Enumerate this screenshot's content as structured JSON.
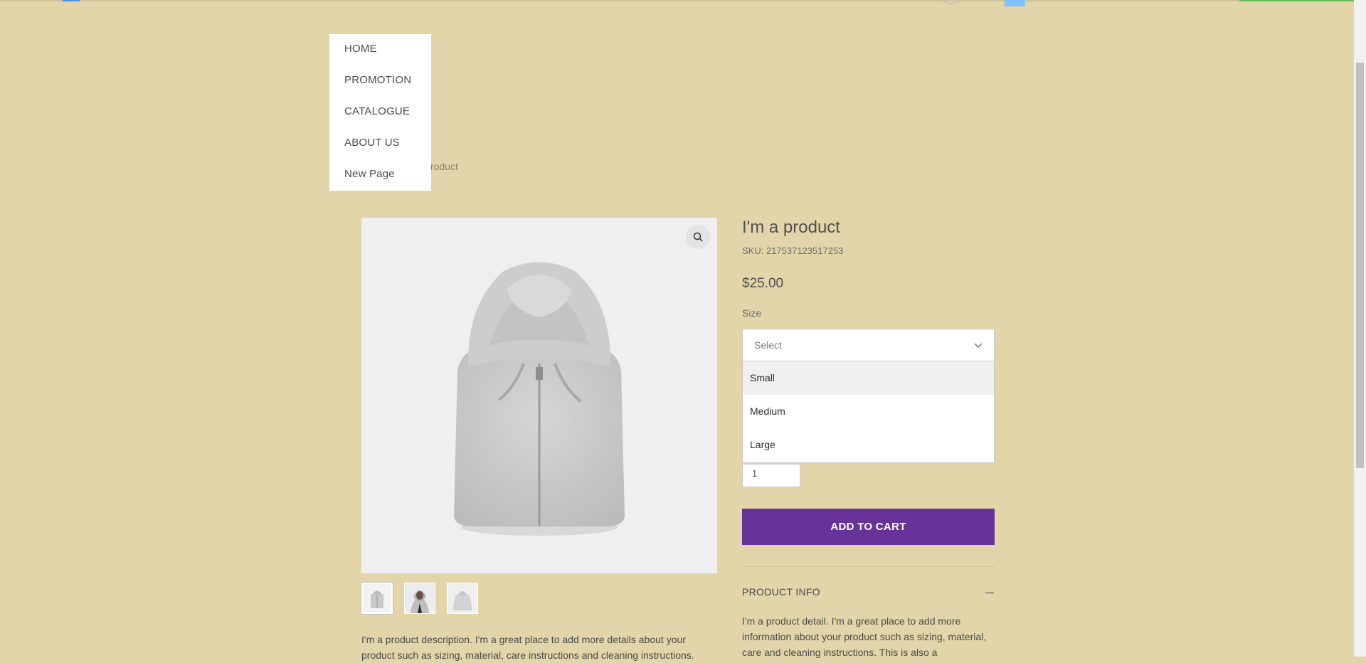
{
  "nav": {
    "items": [
      {
        "label": "HOME"
      },
      {
        "label": "PROMOTION"
      },
      {
        "label": "CATALOGUE"
      },
      {
        "label": "ABOUT US"
      },
      {
        "label": "New Page"
      }
    ]
  },
  "breadcrumb": {
    "current": "roduct"
  },
  "product": {
    "title": "I'm a product",
    "sku": "SKU: 217537123517253",
    "price": "$25.00",
    "description": "I'm a product description. I'm a great place to add more details about your product such as sizing, material, care instructions and cleaning instructions.",
    "image_icon": "hoodie-image",
    "thumbnails": [
      {
        "icon": "hoodie-folded-thumbnail",
        "selected": true
      },
      {
        "icon": "person-hoodie-thumbnail",
        "selected": false
      },
      {
        "icon": "hoodie-back-thumbnail",
        "selected": false
      }
    ]
  },
  "size": {
    "label": "Size",
    "placeholder": "Select",
    "options": [
      {
        "label": "Small",
        "highlighted": true
      },
      {
        "label": "Medium",
        "highlighted": false
      },
      {
        "label": "Large",
        "highlighted": false
      }
    ]
  },
  "quantity": {
    "value": "1"
  },
  "cart": {
    "add_label": "ADD TO CART",
    "accent": "#673399"
  },
  "info": {
    "title": "PRODUCT INFO",
    "detail": "I'm a product detail. I'm a great place to add more information about your product such as sizing, material, care and cleaning instructions. This is also a"
  },
  "colors": {
    "background": "#e2d5aa",
    "accent": "#673399"
  }
}
